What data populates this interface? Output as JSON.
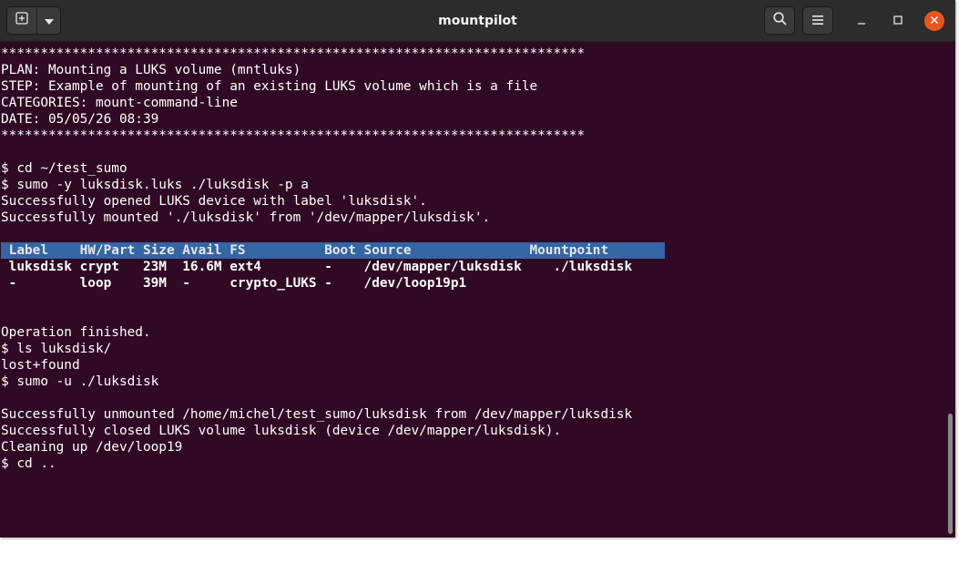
{
  "window": {
    "title": "mountpilot"
  },
  "icons": {
    "new_tab": "new-tab-icon",
    "tab_menu": "chevron-down-icon",
    "search": "search-icon",
    "menu": "hamburger-menu-icon",
    "minimize": "minimize-icon",
    "maximize": "maximize-icon",
    "close": "close-icon"
  },
  "colors": {
    "terminal_bg": "#300a24",
    "terminal_fg": "#ffffff",
    "header_bg": "#3465a4",
    "titlebar_bg": "#2c2c2c",
    "close_button": "#e9541f"
  },
  "terminal": {
    "lines": [
      "**************************************************************************",
      "PLAN: Mounting a LUKS volume (mntluks)",
      "STEP: Example of mounting of an existing LUKS volume which is a file",
      "CATEGORIES: mount-command-line",
      "DATE: 05/05/26 08:39",
      "**************************************************************************",
      "",
      "$ cd ~/test_sumo",
      "$ sumo -y luksdisk.luks ./luksdisk -p a",
      "Successfully opened LUKS device with label 'luksdisk'.",
      "Successfully mounted './luksdisk' from '/dev/mapper/luksdisk'.",
      "",
      " Label    HW/Part Size Avail FS          Boot Source               Mountpoint",
      " luksdisk crypt   23M  16.6M ext4        -    /dev/mapper/luksdisk    ./luksdisk",
      " -        loop    39M  -     crypto_LUKS -    /dev/loop19p1",
      "",
      "",
      "Operation finished.",
      "$ ls luksdisk/",
      "lost+found",
      "$ sumo -u ./luksdisk",
      "",
      "Successfully unmounted /home/michel/test_sumo/luksdisk from /dev/mapper/luksdisk",
      "Successfully closed LUKS volume luksdisk (device /dev/mapper/luksdisk).",
      "Cleaning up /dev/loop19",
      "$ cd .."
    ]
  },
  "scrollbar": {
    "position_fraction": 0.75,
    "visible_fraction": 0.25
  }
}
